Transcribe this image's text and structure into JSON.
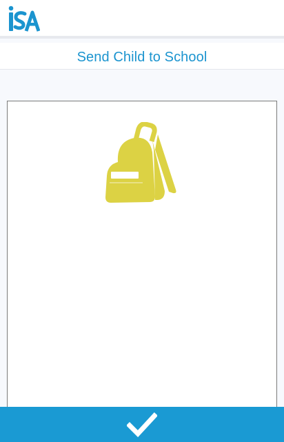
{
  "header": {
    "logo_text": "iSA",
    "logo_icon": "isa-logo",
    "brand_color": "#1b94cf"
  },
  "page": {
    "title": "Send Child to School"
  },
  "card": {
    "icon": "backpack-icon",
    "icon_color": "#dcd244"
  },
  "footer": {
    "confirm_icon": "checkmark-icon",
    "button_color": "#1a9ad3"
  }
}
